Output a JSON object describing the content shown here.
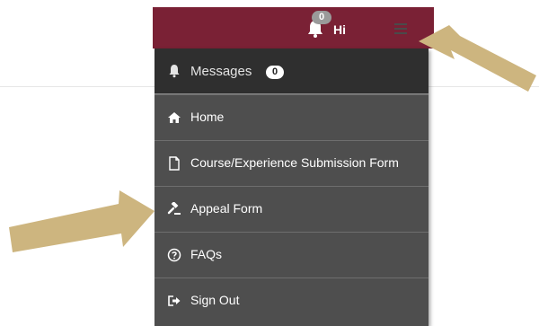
{
  "header": {
    "notification_count": "0",
    "greeting": "Hi"
  },
  "menu": {
    "messages": {
      "label": "Messages",
      "count": "0"
    },
    "items": [
      {
        "label": "Home",
        "icon": "home-icon"
      },
      {
        "label": "Course/Experience Submission Form",
        "icon": "document-icon"
      },
      {
        "label": "Appeal Form",
        "icon": "gavel-icon"
      },
      {
        "label": "FAQs",
        "icon": "question-circle-icon"
      },
      {
        "label": "Sign Out",
        "icon": "sign-out-icon"
      }
    ]
  },
  "colors": {
    "header": "#7a2135",
    "menu_bg": "#4e4e4e",
    "messages_bg": "#2f2f2f",
    "arrow": "#cdb57f"
  }
}
